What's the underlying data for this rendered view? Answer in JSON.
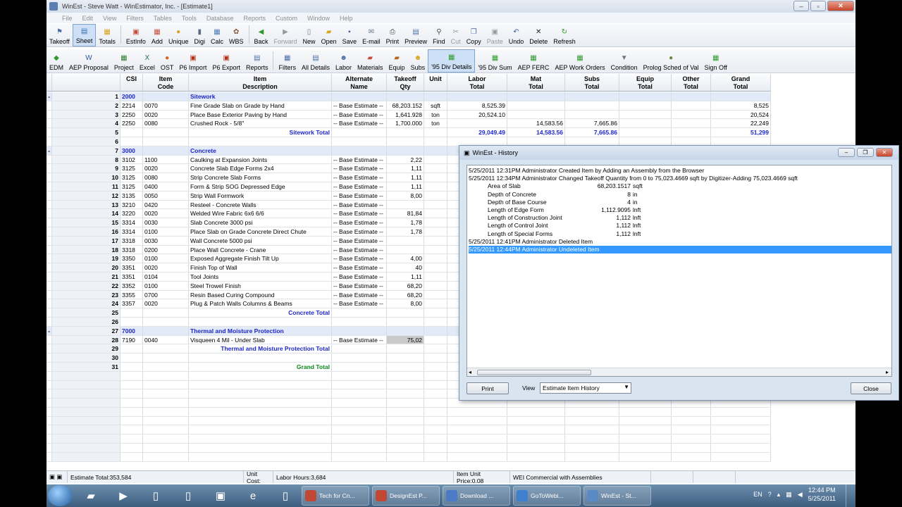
{
  "window": {
    "title": "WinEst - Steve Watt - WinEstimator, Inc. - [Estimate1]"
  },
  "menu": [
    "File",
    "Edit",
    "View",
    "Filters",
    "Tables",
    "Tools",
    "Database",
    "Reports",
    "Custom",
    "Window",
    "Help"
  ],
  "toolbar1": [
    {
      "label": "Takeoff",
      "icon": "takeoff-icon",
      "glyph": "⚑",
      "color": "#4a6fa5"
    },
    {
      "label": "Sheet",
      "icon": "sheet-icon",
      "glyph": "▤",
      "color": "#3b6fb2",
      "selected": true
    },
    {
      "label": "Totals",
      "icon": "totals-icon",
      "glyph": "▦",
      "color": "#d6a21c"
    },
    {
      "sep": true
    },
    {
      "label": "EstInfo",
      "icon": "estinfo-icon",
      "glyph": "▣",
      "color": "#c84a3a"
    },
    {
      "label": "Add",
      "icon": "add-icon",
      "glyph": "▦",
      "color": "#c84a3a"
    },
    {
      "label": "Unique",
      "icon": "unique-icon",
      "glyph": "●",
      "color": "#d9a21a"
    },
    {
      "label": "Digi",
      "icon": "digi-icon",
      "glyph": "▮",
      "color": "#5a6f85"
    },
    {
      "label": "Calc",
      "icon": "calc-icon",
      "glyph": "▦",
      "color": "#4c7bb5"
    },
    {
      "label": "WBS",
      "icon": "wbs-icon",
      "glyph": "✿",
      "color": "#8b5a3c"
    },
    {
      "sep": true
    },
    {
      "label": "Back",
      "icon": "back-icon",
      "glyph": "◀",
      "color": "#2e9a2e"
    },
    {
      "label": "Forward",
      "icon": "forward-icon",
      "glyph": "▶",
      "color": "#9a9a9a",
      "disabled": true
    },
    {
      "label": "New",
      "icon": "new-icon",
      "glyph": "▯",
      "color": "#6a7a8c"
    },
    {
      "label": "Open",
      "icon": "open-icon",
      "glyph": "▰",
      "color": "#d9a21a"
    },
    {
      "label": "Save",
      "icon": "save-icon",
      "glyph": "▪",
      "color": "#3a5f9c"
    },
    {
      "label": "E-mail",
      "icon": "email-icon",
      "glyph": "✉",
      "color": "#6a7a8c"
    },
    {
      "label": "Print",
      "icon": "print-icon",
      "glyph": "⎙",
      "color": "#4a4a4a"
    },
    {
      "label": "Preview",
      "icon": "preview-icon",
      "glyph": "▤",
      "color": "#4a6fa5"
    },
    {
      "label": "Find",
      "icon": "find-icon",
      "glyph": "⚲",
      "color": "#4a4a4a"
    },
    {
      "label": "Cut",
      "icon": "cut-icon",
      "glyph": "✂",
      "color": "#9a9a9a",
      "disabled": true
    },
    {
      "label": "Copy",
      "icon": "copy-icon",
      "glyph": "❐",
      "color": "#4a6fa5"
    },
    {
      "label": "Paste",
      "icon": "paste-icon",
      "glyph": "▣",
      "color": "#9a9a9a",
      "disabled": true
    },
    {
      "label": "Undo",
      "icon": "undo-icon",
      "glyph": "↶",
      "color": "#3a5f9c"
    },
    {
      "label": "Delete",
      "icon": "delete-icon",
      "glyph": "✕",
      "color": "#222"
    },
    {
      "label": "Refresh",
      "icon": "refresh-icon",
      "glyph": "↻",
      "color": "#2e9a2e"
    }
  ],
  "toolbar2": [
    {
      "label": "EDM",
      "icon": "edm-icon",
      "glyph": "◆",
      "color": "#2e9a2e"
    },
    {
      "label": "AEP Proposal",
      "icon": "aep-proposal-icon",
      "glyph": "W",
      "color": "#2b579a"
    },
    {
      "label": "Project",
      "icon": "project-icon",
      "glyph": "▦",
      "color": "#2e7d32"
    },
    {
      "label": "Excel",
      "icon": "excel-icon",
      "glyph": "X",
      "color": "#1e7145"
    },
    {
      "label": "OST",
      "icon": "ost-icon",
      "glyph": "●",
      "color": "#e05a1b"
    },
    {
      "label": "P6 Import",
      "icon": "p6-import-icon",
      "glyph": "▣",
      "color": "#b5341c"
    },
    {
      "label": "P6 Export",
      "icon": "p6-export-icon",
      "glyph": "▣",
      "color": "#b5341c"
    },
    {
      "label": "Reports",
      "icon": "reports-icon",
      "glyph": "▤",
      "color": "#4a6fa5"
    },
    {
      "sep": true
    },
    {
      "label": "Filters",
      "icon": "filters-icon",
      "glyph": "▦",
      "color": "#4a6fa5"
    },
    {
      "label": "All Details",
      "icon": "all-details-icon",
      "glyph": "▤",
      "color": "#4a6fa5"
    },
    {
      "label": "Labor",
      "icon": "labor-icon",
      "glyph": "☻",
      "color": "#4a6fa5"
    },
    {
      "label": "Materials",
      "icon": "materials-icon",
      "glyph": "▰",
      "color": "#c84a3a"
    },
    {
      "label": "Equip",
      "icon": "equip-icon",
      "glyph": "▰",
      "color": "#b5651d"
    },
    {
      "label": "Subs",
      "icon": "subs-icon",
      "glyph": "☻",
      "color": "#d9a21a"
    },
    {
      "label": "'95 Div Details",
      "icon": "div-details-icon",
      "glyph": "▦",
      "color": "#2e9a2e",
      "selected": true
    },
    {
      "label": "'95 Div Sum",
      "icon": "div-sum-icon",
      "glyph": "▦",
      "color": "#2e9a2e"
    },
    {
      "label": "AEP FERC",
      "icon": "aep-ferc-icon",
      "glyph": "▦",
      "color": "#2e9a2e"
    },
    {
      "label": "AEP Work Orders",
      "icon": "aep-work-orders-icon",
      "glyph": "▦",
      "color": "#2e9a2e"
    },
    {
      "label": "Condition",
      "icon": "condition-icon",
      "glyph": "▼",
      "color": "#6a7a8c"
    },
    {
      "label": "Prolog Sched of Val",
      "icon": "prolog-icon",
      "glyph": "●",
      "color": "#6a8a3a"
    },
    {
      "label": "Sign Off",
      "icon": "sign-off-icon",
      "glyph": "▦",
      "color": "#2e9a2e"
    }
  ],
  "grid": {
    "headers": [
      "",
      "",
      "CSI",
      "Item\nCode",
      "Item\nDescription",
      "Alternate\nName",
      "Takeoff\nQty",
      "Unit",
      "Labor\nTotal",
      "Mat\nTotal",
      "Subs\nTotal",
      "Equip\nTotal",
      "Other\nTotal",
      "Grand\nTotal"
    ],
    "rows": [
      {
        "exp": "-",
        "num": "1",
        "type": "section",
        "csi": "2000",
        "desc": "Sitework"
      },
      {
        "num": "2",
        "csi": "2214",
        "code": "0070",
        "desc": "Fine Grade Slab on Grade by Hand",
        "alt": "-- Base Estimate --",
        "qty": "68,203.152",
        "unit": "sqft",
        "labor": "8,525.39",
        "grand": "8,525"
      },
      {
        "num": "3",
        "csi": "2250",
        "code": "0020",
        "desc": "Place Base Exterior Paving by Hand",
        "alt": "-- Base Estimate --",
        "qty": "1,641.928",
        "unit": "ton",
        "labor": "20,524.10",
        "grand": "20,524"
      },
      {
        "num": "4",
        "csi": "2250",
        "code": "0080",
        "desc": "Crushed Rock - 5/8\"",
        "alt": "-- Base Estimate --",
        "qty": "1,700.000",
        "unit": "ton",
        "mat": "14,583.56",
        "subs": "7,665.86",
        "grand": "22,249"
      },
      {
        "num": "5",
        "type": "total-blue",
        "desc": "Sitework Total",
        "labor": "29,049.49",
        "mat": "14,583.56",
        "subs": "7,665.86",
        "grand": "51,299"
      },
      {
        "num": "6"
      },
      {
        "exp": "-",
        "num": "7",
        "type": "section",
        "csi": "3000",
        "desc": "Concrete"
      },
      {
        "num": "8",
        "csi": "3102",
        "code": "1100",
        "desc": "Caulking at Expansion Joints",
        "alt": "-- Base Estimate --",
        "qty": "2,22"
      },
      {
        "num": "9",
        "csi": "3125",
        "code": "0020",
        "desc": "Concrete Slab Edge Forms 2x4",
        "alt": "-- Base Estimate --",
        "qty": "1,11"
      },
      {
        "num": "10",
        "csi": "3125",
        "code": "0080",
        "desc": "Strip Concrete Slab Forms",
        "alt": "-- Base Estimate --",
        "qty": "1,11"
      },
      {
        "num": "11",
        "csi": "3125",
        "code": "0400",
        "desc": "Form & Strip SOG Depressed Edge",
        "alt": "-- Base Estimate --",
        "qty": "1,11"
      },
      {
        "num": "12",
        "csi": "3135",
        "code": "0050",
        "desc": "Strip Wall Formwork",
        "alt": "-- Base Estimate --",
        "qty": "8,00"
      },
      {
        "num": "13",
        "csi": "3210",
        "code": "0420",
        "desc": "Resteel - Concrete Walls",
        "alt": "-- Base Estimate --"
      },
      {
        "num": "14",
        "csi": "3220",
        "code": "0020",
        "desc": "Welded Wire Fabric 6x6 6/6",
        "alt": "-- Base Estimate --",
        "qty": "81,84"
      },
      {
        "num": "15",
        "pencil": true,
        "csi": "3314",
        "code": "0030",
        "desc": "Slab Concrete 3000 psi",
        "alt": "-- Base Estimate --",
        "qty": "1,78"
      },
      {
        "num": "16",
        "csi": "3314",
        "code": "0100",
        "desc": "Place Slab on Grade Concrete Direct Chute",
        "alt": "-- Base Estimate --",
        "qty": "1,78"
      },
      {
        "num": "17",
        "pencil": true,
        "csi": "3318",
        "code": "0030",
        "desc": "Wall Concrete 5000 psi",
        "alt": "-- Base Estimate --"
      },
      {
        "num": "18",
        "csi": "3318",
        "code": "0200",
        "desc": "Place Wall Concrete - Crane",
        "alt": "-- Base Estimate --"
      },
      {
        "num": "19",
        "csi": "3350",
        "code": "0100",
        "desc": "Exposed Aggregate Finish Tilt Up",
        "alt": "-- Base Estimate --",
        "qty": "4,00"
      },
      {
        "num": "20",
        "csi": "3351",
        "code": "0020",
        "desc": "Finish Top of Wall",
        "alt": "-- Base Estimate --",
        "qty": "40"
      },
      {
        "num": "21",
        "csi": "3351",
        "code": "0104",
        "desc": "Tool Joints",
        "alt": "-- Base Estimate --",
        "qty": "1,11"
      },
      {
        "num": "22",
        "csi": "3352",
        "code": "0100",
        "desc": "Steel Trowel Finish",
        "alt": "-- Base Estimate --",
        "qty": "68,20"
      },
      {
        "num": "23",
        "csi": "3355",
        "code": "0700",
        "desc": "Resin Based Curing Compound",
        "alt": "-- Base Estimate --",
        "qty": "68,20"
      },
      {
        "num": "24",
        "csi": "3357",
        "code": "0020",
        "desc": "Plug & Patch Walls Columns & Beams",
        "alt": "-- Base Estimate --",
        "qty": "8,00"
      },
      {
        "num": "25",
        "type": "total-blue",
        "desc": "Concrete Total"
      },
      {
        "num": "26"
      },
      {
        "exp": "-",
        "num": "27",
        "type": "section",
        "csi": "7000",
        "desc": "Thermal and Moisture Protection"
      },
      {
        "num": "28",
        "csi": "7190",
        "code": "0040",
        "desc": "Visqueen 4 Mil - Under Slab",
        "alt": "-- Base Estimate --",
        "qty": "75,02",
        "qtyHighlight": true
      },
      {
        "num": "29",
        "type": "total-blue",
        "desc": "Thermal and Moisture Protection Total"
      },
      {
        "num": "30"
      },
      {
        "num": "31",
        "type": "total-green",
        "desc": "Grand Total"
      },
      {},
      {},
      {},
      {},
      {},
      {},
      {},
      {},
      {},
      {}
    ]
  },
  "status": {
    "estimate_total": "Estimate Total:353,584",
    "unit_cost": "Unit Cost:",
    "labor_hours": "Labor Hours:3,684",
    "item_unit_price": "Item Unit Price:0.08",
    "db": "WEI Commercial with Assemblies"
  },
  "dialog": {
    "title": "WinEst - History",
    "lines": [
      {
        "text": "5/25/2011 12:31PM Administrator Created Item by Adding an Assembly from the Browser"
      },
      {
        "text": "5/25/2011 12:34PM Administrator Changed Takeoff Quantity from 0 to 75,023.4669 sqft by Digitizer-Adding 75,023.4669 sqft"
      },
      {
        "label": "Area of Slab",
        "value": "68,203.1517",
        "unit": "sqft"
      },
      {
        "label": "Depth of Concrete",
        "value": "8",
        "unit": "in"
      },
      {
        "label": "Depth of Base Course",
        "value": "4",
        "unit": "in"
      },
      {
        "label": "Length of Edge Form",
        "value": "1,112.9095",
        "unit": "lnft"
      },
      {
        "label": "Length of Construction Joint",
        "value": "1,112",
        "unit": "lnft"
      },
      {
        "label": "Length of Control Joint",
        "value": "1,112",
        "unit": "lnft"
      },
      {
        "label": "Length of Special Forms",
        "value": "1,112",
        "unit": "lnft"
      },
      {
        "text": "5/25/2011 12:41PM Administrator Deleted Item"
      },
      {
        "text": "5/25/2011 12:44PM Administrator Undeleted Item",
        "selected": true
      }
    ],
    "print_label": "Print",
    "view_label": "View",
    "view_value": "Estimate Item History",
    "close_label": "Close"
  },
  "taskbar": {
    "tasks": [
      "Tech for Cn...",
      "DesignEst P...",
      "Download ...",
      "GoToWebi...",
      "WinEst - St..."
    ],
    "lang": "EN",
    "time": "12:44 PM",
    "date": "5/25/2011"
  }
}
